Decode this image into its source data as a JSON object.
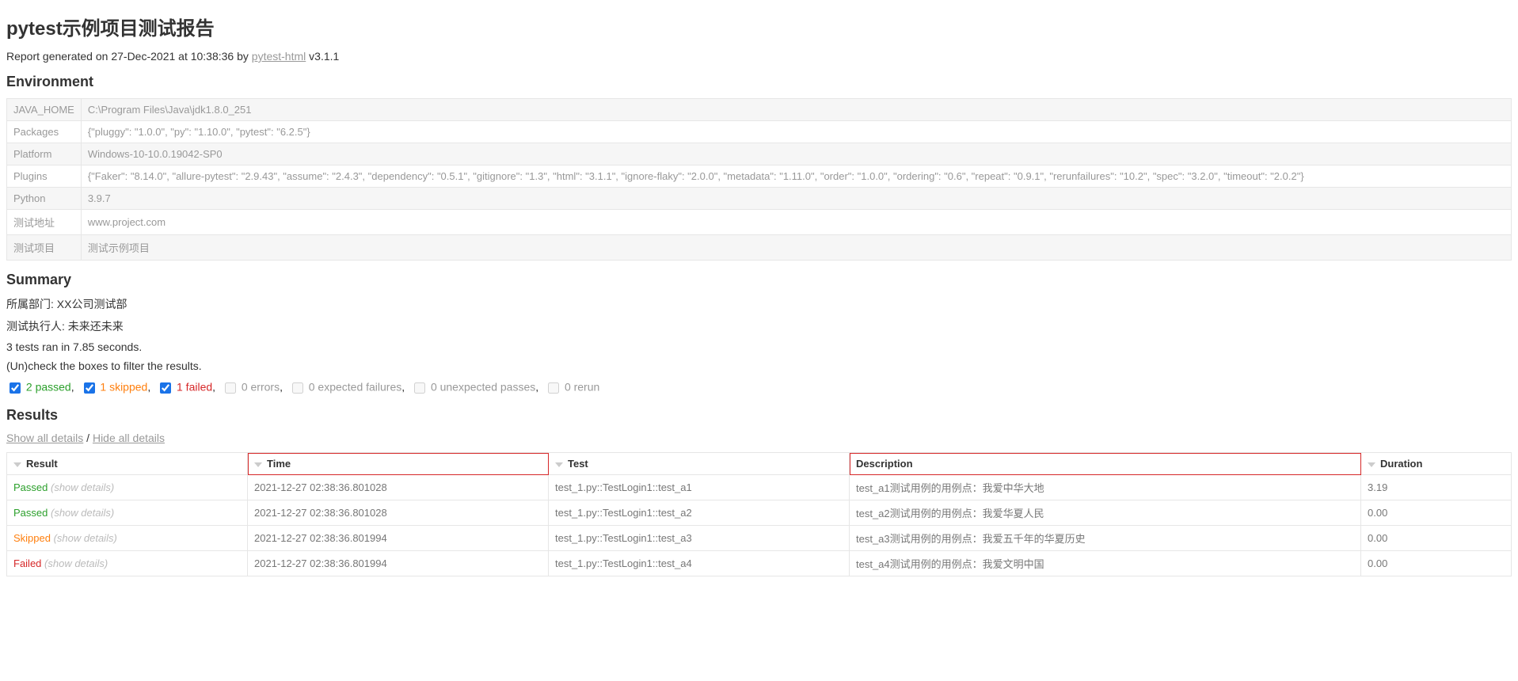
{
  "title": "pytest示例项目测试报告",
  "report_generated_prefix": "Report generated on ",
  "report_generated_date": "27-Dec-2021 at 10:38:36",
  "report_generated_by": " by ",
  "plugin_link_text": "pytest-html",
  "plugin_version": " v3.1.1",
  "environment_heading": "Environment",
  "environment": [
    {
      "key": "JAVA_HOME",
      "value": "C:\\Program Files\\Java\\jdk1.8.0_251"
    },
    {
      "key": "Packages",
      "value": "{\"pluggy\": \"1.0.0\", \"py\": \"1.10.0\", \"pytest\": \"6.2.5\"}"
    },
    {
      "key": "Platform",
      "value": "Windows-10-10.0.19042-SP0"
    },
    {
      "key": "Plugins",
      "value": "{\"Faker\": \"8.14.0\", \"allure-pytest\": \"2.9.43\", \"assume\": \"2.4.3\", \"dependency\": \"0.5.1\", \"gitignore\": \"1.3\", \"html\": \"3.1.1\", \"ignore-flaky\": \"2.0.0\", \"metadata\": \"1.11.0\", \"order\": \"1.0.0\", \"ordering\": \"0.6\", \"repeat\": \"0.9.1\", \"rerunfailures\": \"10.2\", \"spec\": \"3.2.0\", \"timeout\": \"2.0.2\"}"
    },
    {
      "key": "Python",
      "value": "3.9.7"
    },
    {
      "key": "测试地址",
      "value": "www.project.com"
    },
    {
      "key": "测试项目",
      "value": "测试示例项目"
    }
  ],
  "summary_heading": "Summary",
  "summary": {
    "department_label": "所属部门: ",
    "department_value": "XX公司测试部",
    "executor_label": "测试执行人: ",
    "executor_value": "未来还未来",
    "tests_ran": "3 tests ran in 7.85 seconds.",
    "filter_hint": "(Un)check the boxes to filter the results."
  },
  "filters": {
    "passed": "2 passed",
    "skipped": "1 skipped",
    "failed": "1 failed",
    "errors": "0 errors",
    "xfail": "0 expected failures",
    "xpass": "0 unexpected passes",
    "rerun": "0 rerun"
  },
  "results_heading": "Results",
  "links": {
    "show_all": "Show all details",
    "hide_all": "Hide all details",
    "separator": " / "
  },
  "headers": {
    "result": "Result",
    "time": "Time",
    "test": "Test",
    "description": "Description",
    "duration": "Duration"
  },
  "show_details_text": "(show details)",
  "rows": [
    {
      "result": "Passed",
      "result_class": "passed",
      "time": "2021-12-27 02:38:36.801028",
      "test": "test_1.py::TestLogin1::test_a1",
      "description": "test_a1测试用例的用例点：我爱中华大地",
      "duration": "3.19"
    },
    {
      "result": "Passed",
      "result_class": "passed",
      "time": "2021-12-27 02:38:36.801028",
      "test": "test_1.py::TestLogin1::test_a2",
      "description": "test_a2测试用例的用例点：我爱华夏人民",
      "duration": "0.00"
    },
    {
      "result": "Skipped",
      "result_class": "skipped",
      "time": "2021-12-27 02:38:36.801994",
      "test": "test_1.py::TestLogin1::test_a3",
      "description": "test_a3测试用例的用例点：我爱五千年的华夏历史",
      "duration": "0.00"
    },
    {
      "result": "Failed",
      "result_class": "failed",
      "time": "2021-12-27 02:38:36.801994",
      "test": "test_1.py::TestLogin1::test_a4",
      "description": "test_a4测试用例的用例点：我爱文明中国",
      "duration": "0.00"
    }
  ]
}
